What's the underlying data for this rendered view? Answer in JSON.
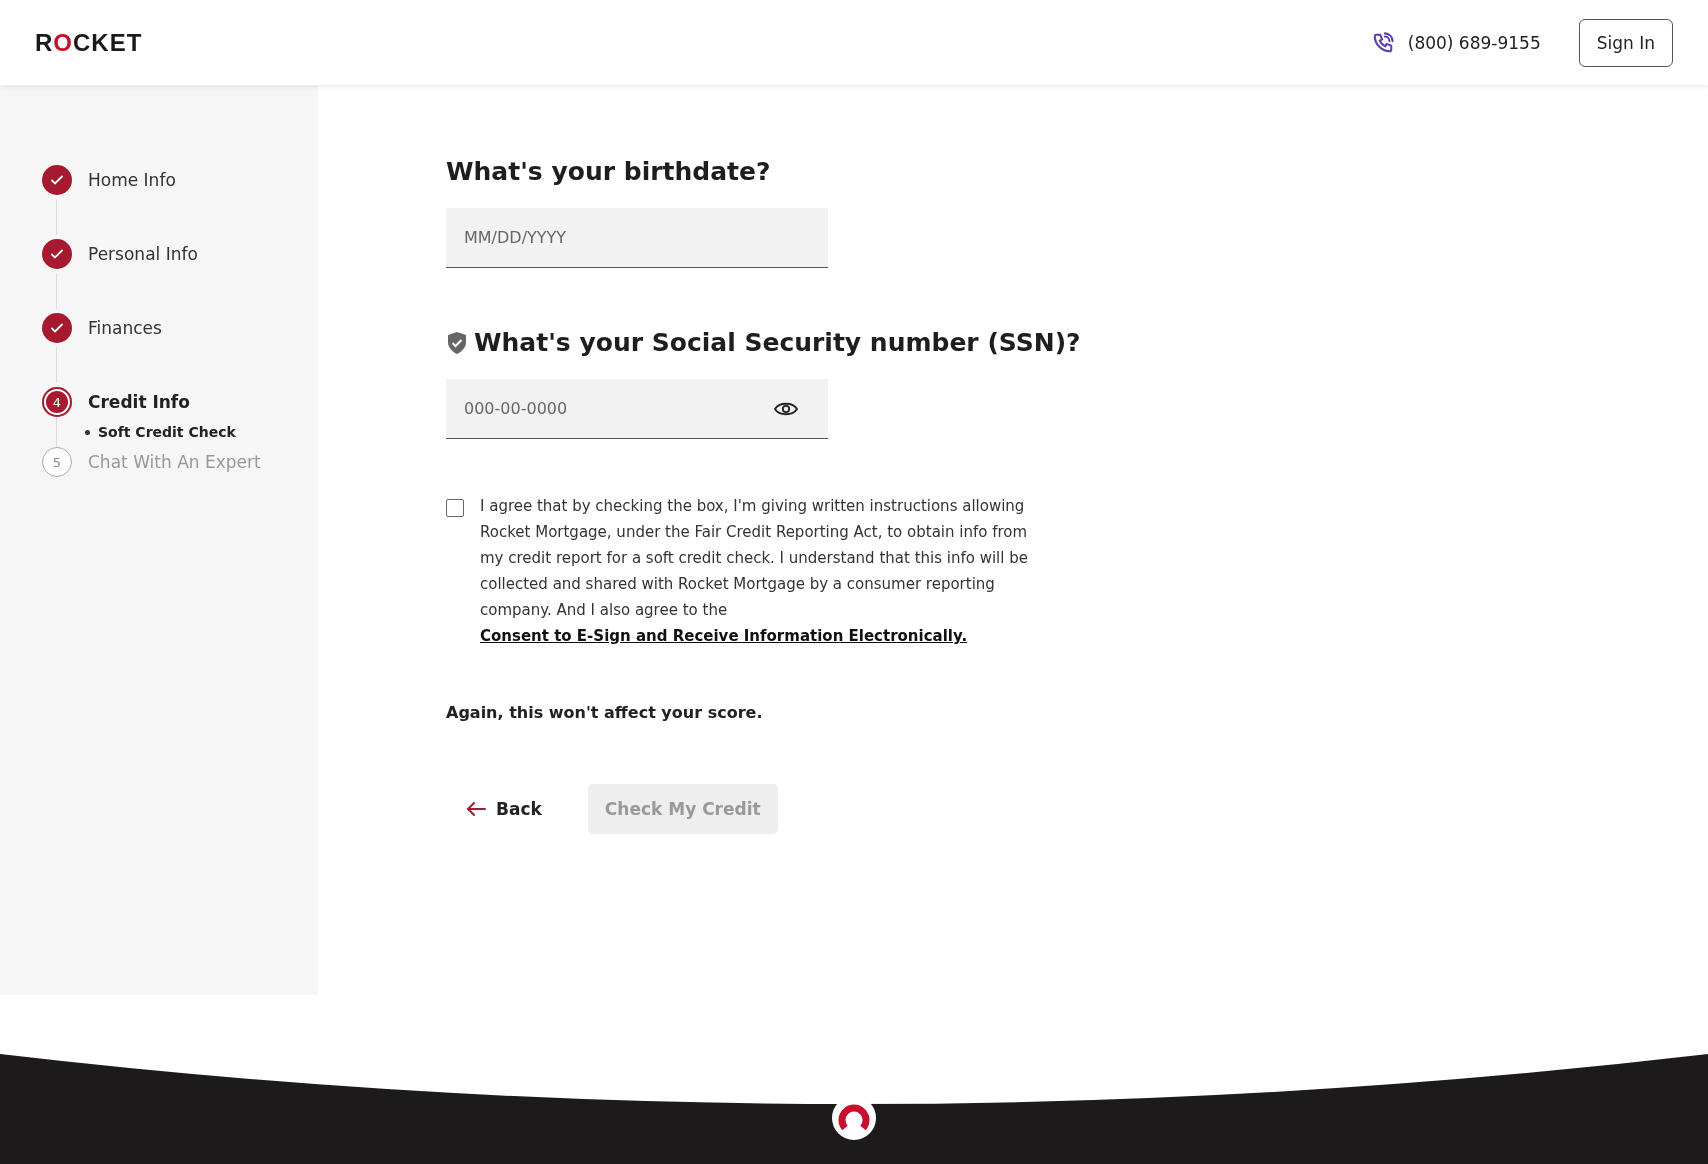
{
  "header": {
    "logo": "ROCKET",
    "phone": "(800) 689-9155",
    "sign_in": "Sign In"
  },
  "steps": [
    {
      "label": "Home Info",
      "kind": "done"
    },
    {
      "label": "Personal Info",
      "kind": "done"
    },
    {
      "label": "Finances",
      "kind": "done"
    },
    {
      "marker": "4",
      "label": "Credit Info",
      "kind": "current",
      "children": [
        {
          "label": "Soft Credit Check",
          "selected": true
        }
      ]
    },
    {
      "marker": "5",
      "label": "Chat With An Expert",
      "kind": "upcoming"
    }
  ],
  "birthdate": {
    "question": "What's your birthdate?",
    "placeholder": "MM/DD/YYYY"
  },
  "ssn": {
    "question": "What's your Social Security number (SSN)?",
    "placeholder": "000-00-0000"
  },
  "consent": {
    "checked": false,
    "text": "I agree that by checking the box, I'm giving written instructions allowing Rocket Mortgage, under the Fair Credit Reporting Act, to obtain info from my credit report for a soft credit check. I understand that this info will be collected and shared with Rocket Mortgage by a consumer reporting company. And I also agree to the",
    "link": "Consent to E-Sign and Receive Information Electronically."
  },
  "note": "Again, this won't affect your score.",
  "buttons": {
    "back": "Back",
    "submit": "Check My Credit",
    "submit_disabled": true
  }
}
